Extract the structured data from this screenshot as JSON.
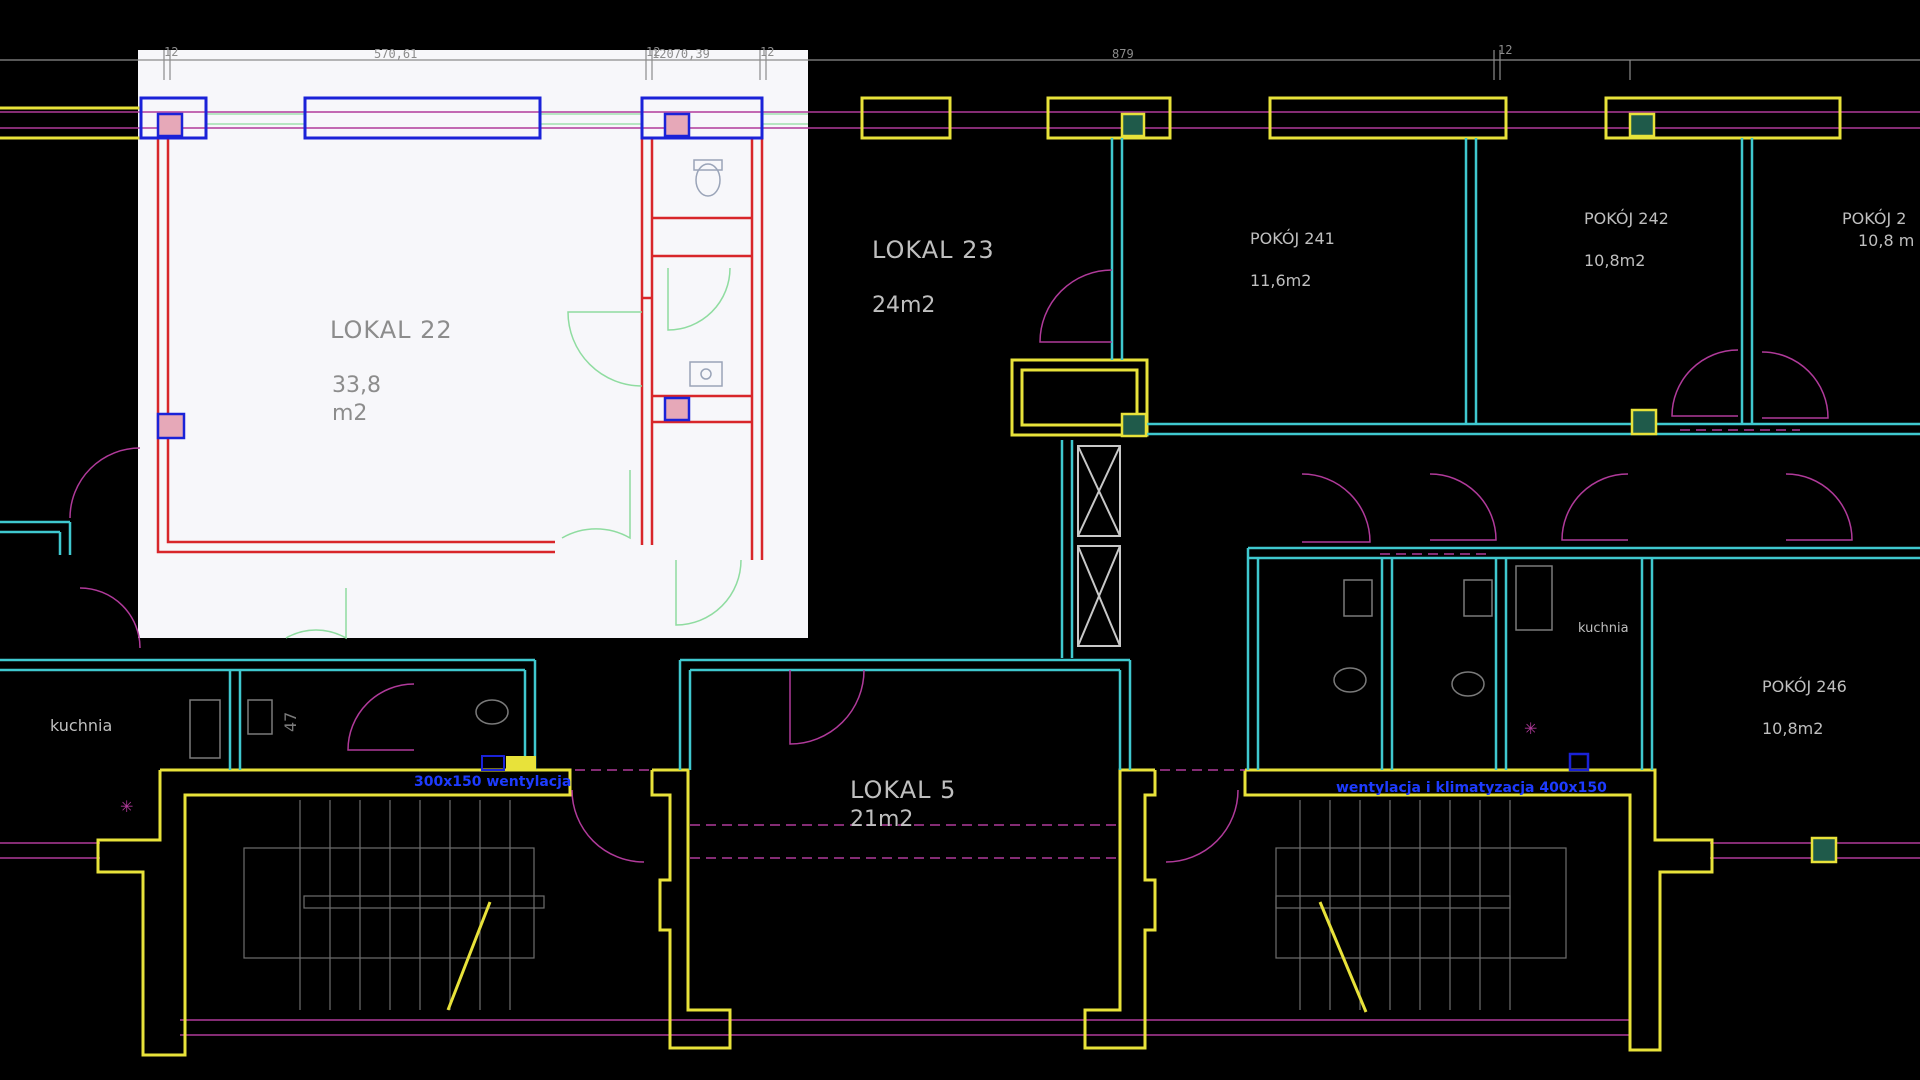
{
  "colors": {
    "background": "#000000",
    "highlight_panel": "#f7f7fa",
    "wall_yellow": "#e8e23a",
    "wall_cyan": "#3fc8cf",
    "wall_red": "#d8262a",
    "wall_blue": "#1a22d8",
    "door_magenta": "#b03a9a",
    "door_green": "#8fdca0",
    "label_light": "#bfbfbf",
    "label_dark": "#8c8c8c",
    "note_blue": "#1d3bff"
  },
  "dimensions": {
    "d1": "12",
    "d2": "570,61",
    "d3": "12",
    "d4": "12070,39",
    "d5": "12",
    "d6": "879",
    "d7": "12"
  },
  "rooms": {
    "lokal22": {
      "name": "LOKAL 22",
      "area_line1": "33,8",
      "area_line2": "m2"
    },
    "lokal23": {
      "name": "LOKAL 23",
      "area": "24m2"
    },
    "pokoj241": {
      "name": "POKÓJ 241",
      "area": "11,6m2"
    },
    "pokoj242": {
      "name": "POKÓJ 242",
      "area": "10,8m2"
    },
    "pokoj243": {
      "name": "POKÓJ 2",
      "area": "10,8 m"
    },
    "lokal5": {
      "name": "LOKAL 5",
      "area": "21m2"
    },
    "pokoj246": {
      "name": "POKÓJ 246",
      "area": "10,8m2"
    },
    "kuchnia_left": {
      "name": "kuchnia"
    },
    "kuchnia_right": {
      "name": "kuchnia"
    }
  },
  "annotations": {
    "note_left": "300x150 wentylacja",
    "note_right": "wentylacja i klimatyzacja 400x150",
    "fixture_label": "47"
  }
}
